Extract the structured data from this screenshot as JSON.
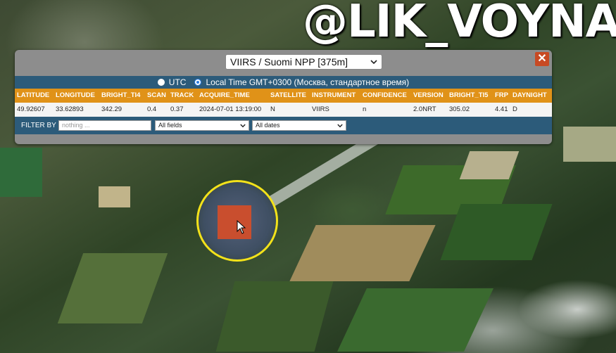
{
  "watermark": "@LIK_VOYNA",
  "popup": {
    "satellite_select": "VIIRS / Suomi NPP [375m]",
    "close_label": "✕",
    "time": {
      "utc_label": "UTC",
      "local_label": "Local Time GMT+0300 (Москва, стандартное время)",
      "selected": "local"
    },
    "columns": [
      "LATITUDE",
      "LONGITUDE",
      "BRIGHT_TI4",
      "SCAN",
      "TRACK",
      "ACQUIRE_TIME",
      "SATELLITE",
      "INSTRUMENT",
      "CONFIDENCE",
      "VERSION",
      "BRIGHT_TI5",
      "FRP",
      "DAYNIGHT"
    ],
    "row": [
      "49.92607",
      "33.62893",
      "342.29",
      "0.4",
      "0.37",
      "2024-07-01 13:19:00",
      "N",
      "VIIRS",
      "n",
      "2.0NRT",
      "305.02",
      "4.41",
      "D"
    ],
    "filter": {
      "label": "FILTER BY",
      "placeholder": "nothing ...",
      "field_select": "All fields",
      "date_select": "All dates"
    }
  },
  "colors": {
    "header": "#e09218",
    "bar": "#2c5b7a",
    "fire": "#c94e2e",
    "ring": "#f3e21a"
  }
}
